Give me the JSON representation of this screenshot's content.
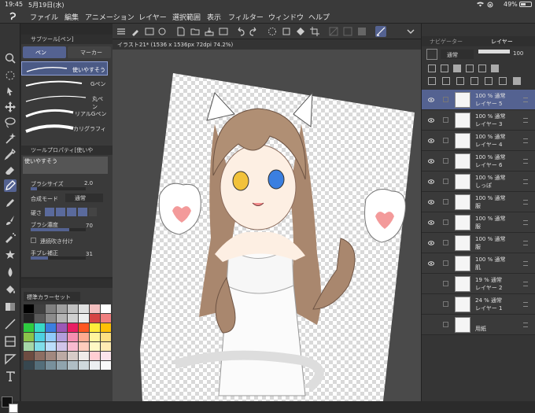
{
  "status": {
    "time": "19:45",
    "date": "5月19日(水)",
    "battery": "49%"
  },
  "menu": [
    "ファイル",
    "編集",
    "アニメーション",
    "レイヤー",
    "選択範囲",
    "表示",
    "フィルター",
    "ウィンドウ",
    "ヘルプ"
  ],
  "subtool": {
    "title": "サブツール[ペン]",
    "tabs": [
      "ペン",
      "マーカー"
    ],
    "brushes": [
      "使いやすそう",
      "Gペン",
      "丸ペン",
      "リアルGペン",
      "カリグラフィ"
    ]
  },
  "toolprop": {
    "title": "ツールプロパティ[使いや",
    "preset": "使いやすそう",
    "brush_size_label": "ブラシサイズ",
    "brush_size_value": "2.0",
    "blend_label": "合成モード",
    "blend_value": "通常",
    "hardness_label": "硬さ",
    "density_label": "ブラシ濃度",
    "density_value": "70",
    "continuous_label": "連続吹き付け",
    "stabilization_label": "手ブレ補正",
    "stabilization_value": "31"
  },
  "colorset": {
    "name": "標準カラーセット"
  },
  "document": {
    "tab": "イラスト21* (1536 x 1536px 72dpi 74.2%)"
  },
  "right": {
    "tabs": [
      "ナビゲーター",
      "レイヤー"
    ],
    "blend": "通常",
    "opacity": "100"
  },
  "layers": [
    {
      "pct": "100 %",
      "mode": "通常",
      "name": "レイヤー 5",
      "active": true,
      "visible": true
    },
    {
      "pct": "100 %",
      "mode": "通常",
      "name": "レイヤー 3",
      "active": false,
      "visible": true
    },
    {
      "pct": "100 %",
      "mode": "通常",
      "name": "レイヤー 4",
      "active": false,
      "visible": true
    },
    {
      "pct": "100 %",
      "mode": "通常",
      "name": "レイヤー 6",
      "active": false,
      "visible": true
    },
    {
      "pct": "100 %",
      "mode": "通常",
      "name": "しっぽ",
      "active": false,
      "visible": true
    },
    {
      "pct": "100 %",
      "mode": "通常",
      "name": "服",
      "active": false,
      "visible": true
    },
    {
      "pct": "100 %",
      "mode": "通常",
      "name": "服",
      "active": false,
      "visible": true
    },
    {
      "pct": "100 %",
      "mode": "通常",
      "name": "服",
      "active": false,
      "visible": true
    },
    {
      "pct": "100 %",
      "mode": "通常",
      "name": "肌",
      "active": false,
      "visible": true
    },
    {
      "pct": "19 %",
      "mode": "通常",
      "name": "レイヤー 2",
      "active": false,
      "visible": false
    },
    {
      "pct": "24 %",
      "mode": "通常",
      "name": "レイヤー 1",
      "active": false,
      "visible": false
    },
    {
      "pct": "",
      "mode": "",
      "name": "用紙",
      "active": false,
      "visible": false
    }
  ],
  "colors": {
    "accent": "#546291",
    "main_color": "#111111",
    "sub_color": "#ffffff"
  },
  "icons": [
    "move-icon",
    "lasso-icon",
    "pen-icon",
    "eraser-icon",
    "fill-icon",
    "text-icon",
    "eyedropper-icon",
    "undo-icon",
    "redo-icon",
    "eye-icon"
  ]
}
